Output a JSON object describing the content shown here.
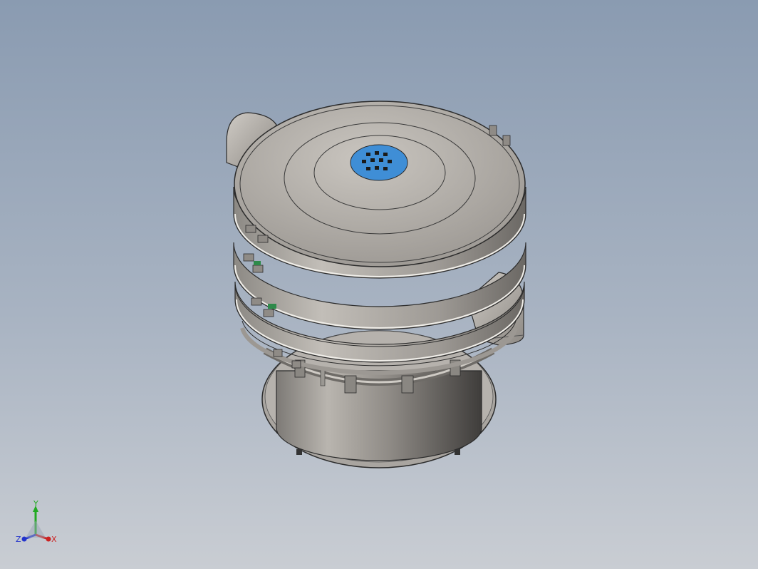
{
  "viewport": {
    "background_top": "#8a9bb1",
    "background_bottom": "#c9cdd3"
  },
  "model": {
    "body_color": "#b8b4ad",
    "screen_color": "#3f8ed6",
    "clamp_accent": "#2e8a4a"
  },
  "triad": {
    "x_label": "X",
    "y_label": "Y",
    "z_label": "Z",
    "x_color": "#cc2222",
    "y_color": "#22aa22",
    "z_color": "#2233cc"
  }
}
